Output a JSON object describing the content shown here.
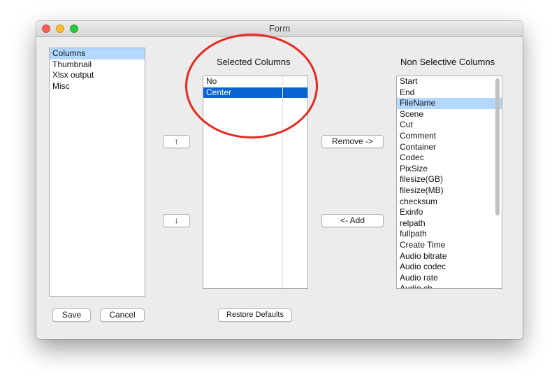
{
  "window": {
    "title": "Form",
    "traffic_lights": [
      {
        "name": "close",
        "color": "#fc5f57"
      },
      {
        "name": "minimize",
        "color": "#fdbc2e"
      },
      {
        "name": "zoom",
        "color": "#2ac840"
      }
    ]
  },
  "sidebar": {
    "items": [
      "Columns",
      "Thumbnail",
      "Xlsx output",
      "Misc"
    ],
    "selected_index": 0
  },
  "selected_columns": {
    "heading": "Selected Columns",
    "items": [
      "No",
      "Center"
    ],
    "selected_index": 1
  },
  "non_selective_columns": {
    "heading": "Non Selective Columns",
    "items": [
      "Start",
      "End",
      "FileName",
      "Scene",
      "Cut",
      "Comment",
      "Container",
      "Codec",
      "PixSize",
      "filesize(GB)",
      "filesize(MB)",
      "checksum",
      "Exinfo",
      "relpath",
      "fullpath",
      "Create Time",
      "Audio bitrate",
      "Audio codec",
      "Audio rate",
      "Audio ch"
    ],
    "selected_index": 2
  },
  "buttons": {
    "move_up": "↑",
    "move_down": "↓",
    "remove": "Remove ->",
    "add": "<- Add",
    "save": "Save",
    "cancel": "Cancel",
    "restore_defaults": "Restore Defaults"
  },
  "colors": {
    "selection_focused": "#0a64d2",
    "selection_unfocused": "#b3d7ff",
    "annotation": "#e8291d"
  }
}
